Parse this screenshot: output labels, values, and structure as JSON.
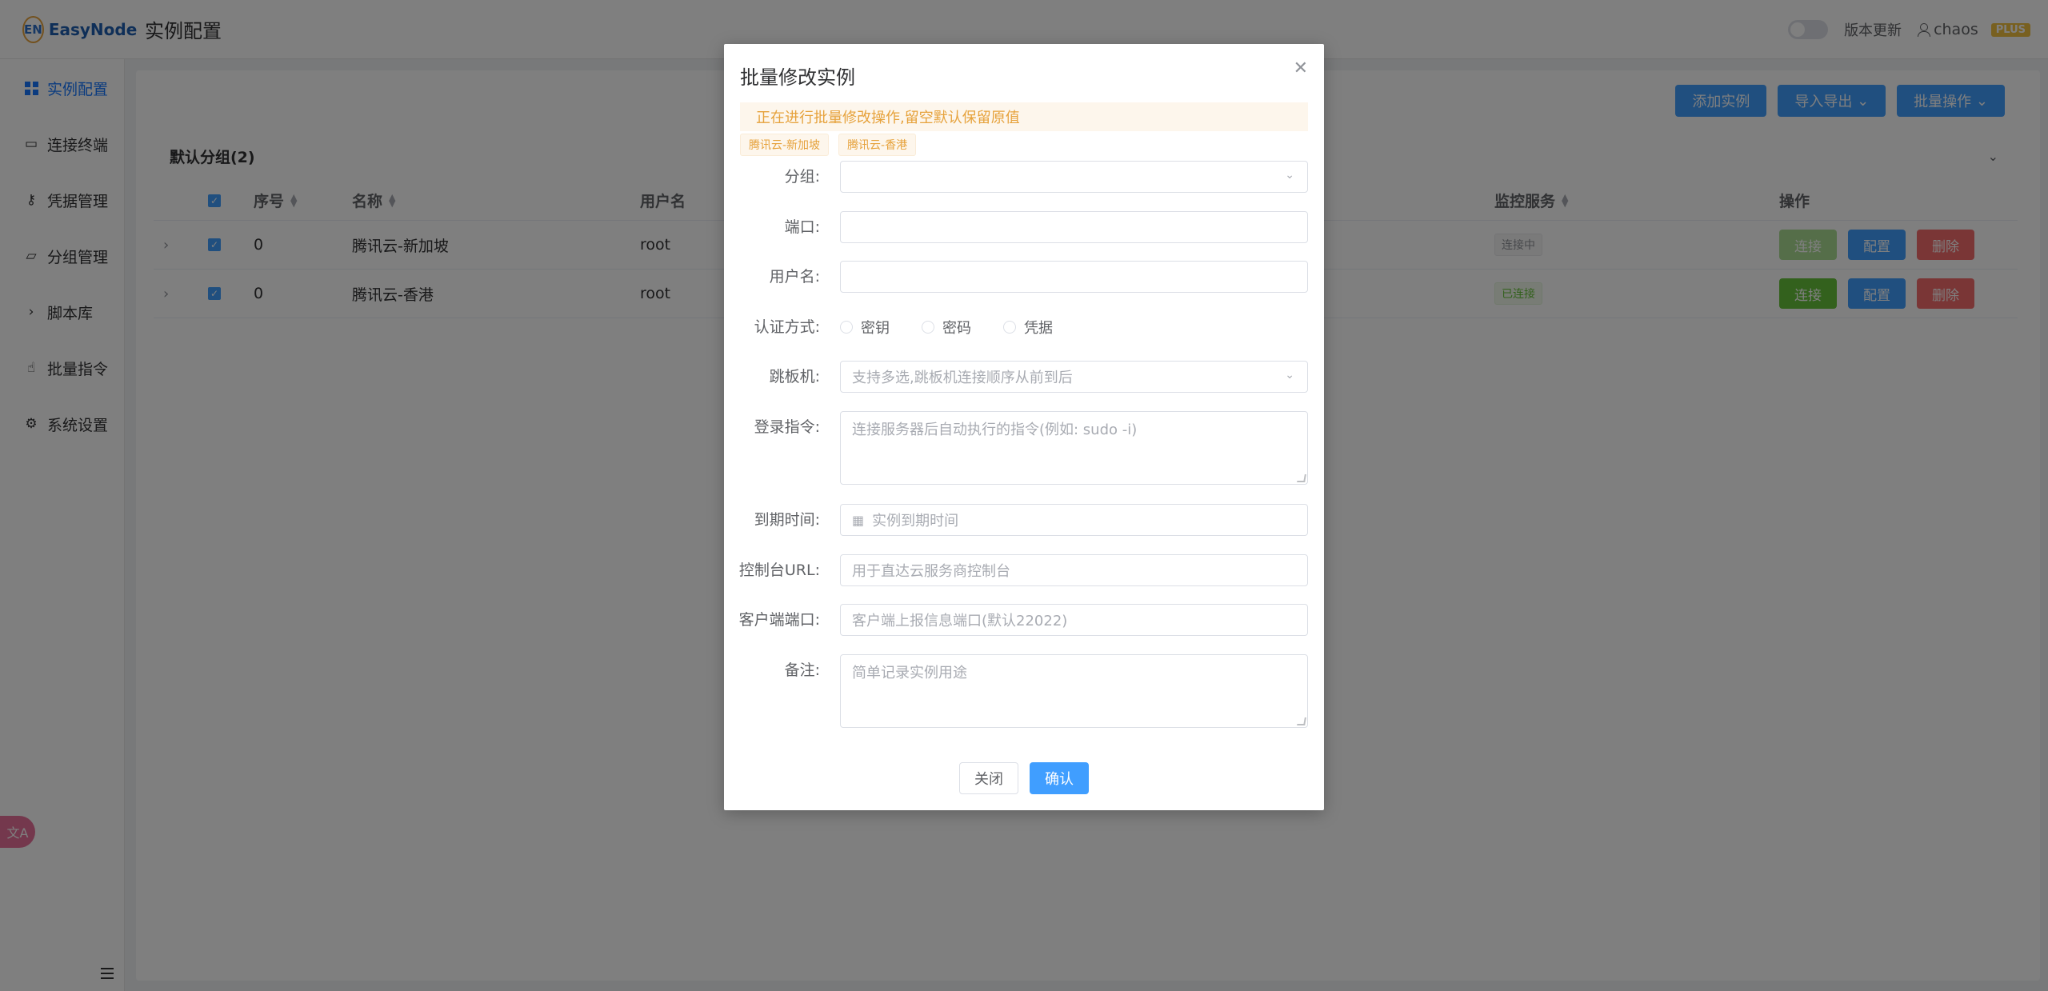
{
  "header": {
    "logo_mark": "EN",
    "logo_text": "EasyNode",
    "title": "实例配置",
    "version_update": "版本更新",
    "username": "chaos",
    "plus_badge": "PLUS"
  },
  "sidebar": {
    "items": [
      {
        "label": "实例配置",
        "icon": "grid-icon"
      },
      {
        "label": "连接终端",
        "icon": "terminal-icon"
      },
      {
        "label": "凭据管理",
        "icon": "key-icon"
      },
      {
        "label": "分组管理",
        "icon": "folder-icon"
      },
      {
        "label": "脚本库",
        "icon": "chevron-right-icon"
      },
      {
        "label": "批量指令",
        "icon": "hand-icon"
      },
      {
        "label": "系统设置",
        "icon": "gear-icon"
      }
    ],
    "translate_label": "文A"
  },
  "toolbar": {
    "add_instance": "添加实例",
    "import_export": "导入导出",
    "batch_ops": "批量操作"
  },
  "group": {
    "title": "默认分组(2)"
  },
  "table": {
    "headers": {
      "index": "序号",
      "name": "名称",
      "username": "用户名",
      "monitor": "监控服务",
      "actions": "操作"
    },
    "rows": [
      {
        "index": "0",
        "name": "腾讯云-新加坡",
        "username": "root",
        "status": "连接中",
        "connect": "连接",
        "config": "配置",
        "delete": "删除"
      },
      {
        "index": "0",
        "name": "腾讯云-香港",
        "username": "root",
        "status": "已连接",
        "connect": "连接",
        "config": "配置",
        "delete": "删除"
      }
    ]
  },
  "dialog": {
    "title": "批量修改实例",
    "alert": "正在进行批量修改操作,留空默认保留原值",
    "tags": [
      "腾讯云-新加坡",
      "腾讯云-香港"
    ],
    "labels": {
      "group": "分组:",
      "port": "端口:",
      "username": "用户名:",
      "auth": "认证方式:",
      "jump": "跳板机:",
      "login_cmd": "登录指令:",
      "expire": "到期时间:",
      "console_url": "控制台URL:",
      "client_port": "客户端端口:",
      "remark": "备注:"
    },
    "auth_options": [
      "密钥",
      "密码",
      "凭据"
    ],
    "placeholders": {
      "jump": "支持多选,跳板机连接顺序从前到后",
      "login_cmd": "连接服务器后自动执行的指令(例如: sudo -i)",
      "expire": "实例到期时间",
      "console_url": "用于直达云服务商控制台",
      "client_port": "客户端上报信息端口(默认22022)",
      "remark": "简单记录实例用途"
    },
    "close_button": "关闭",
    "confirm_button": "确认"
  }
}
